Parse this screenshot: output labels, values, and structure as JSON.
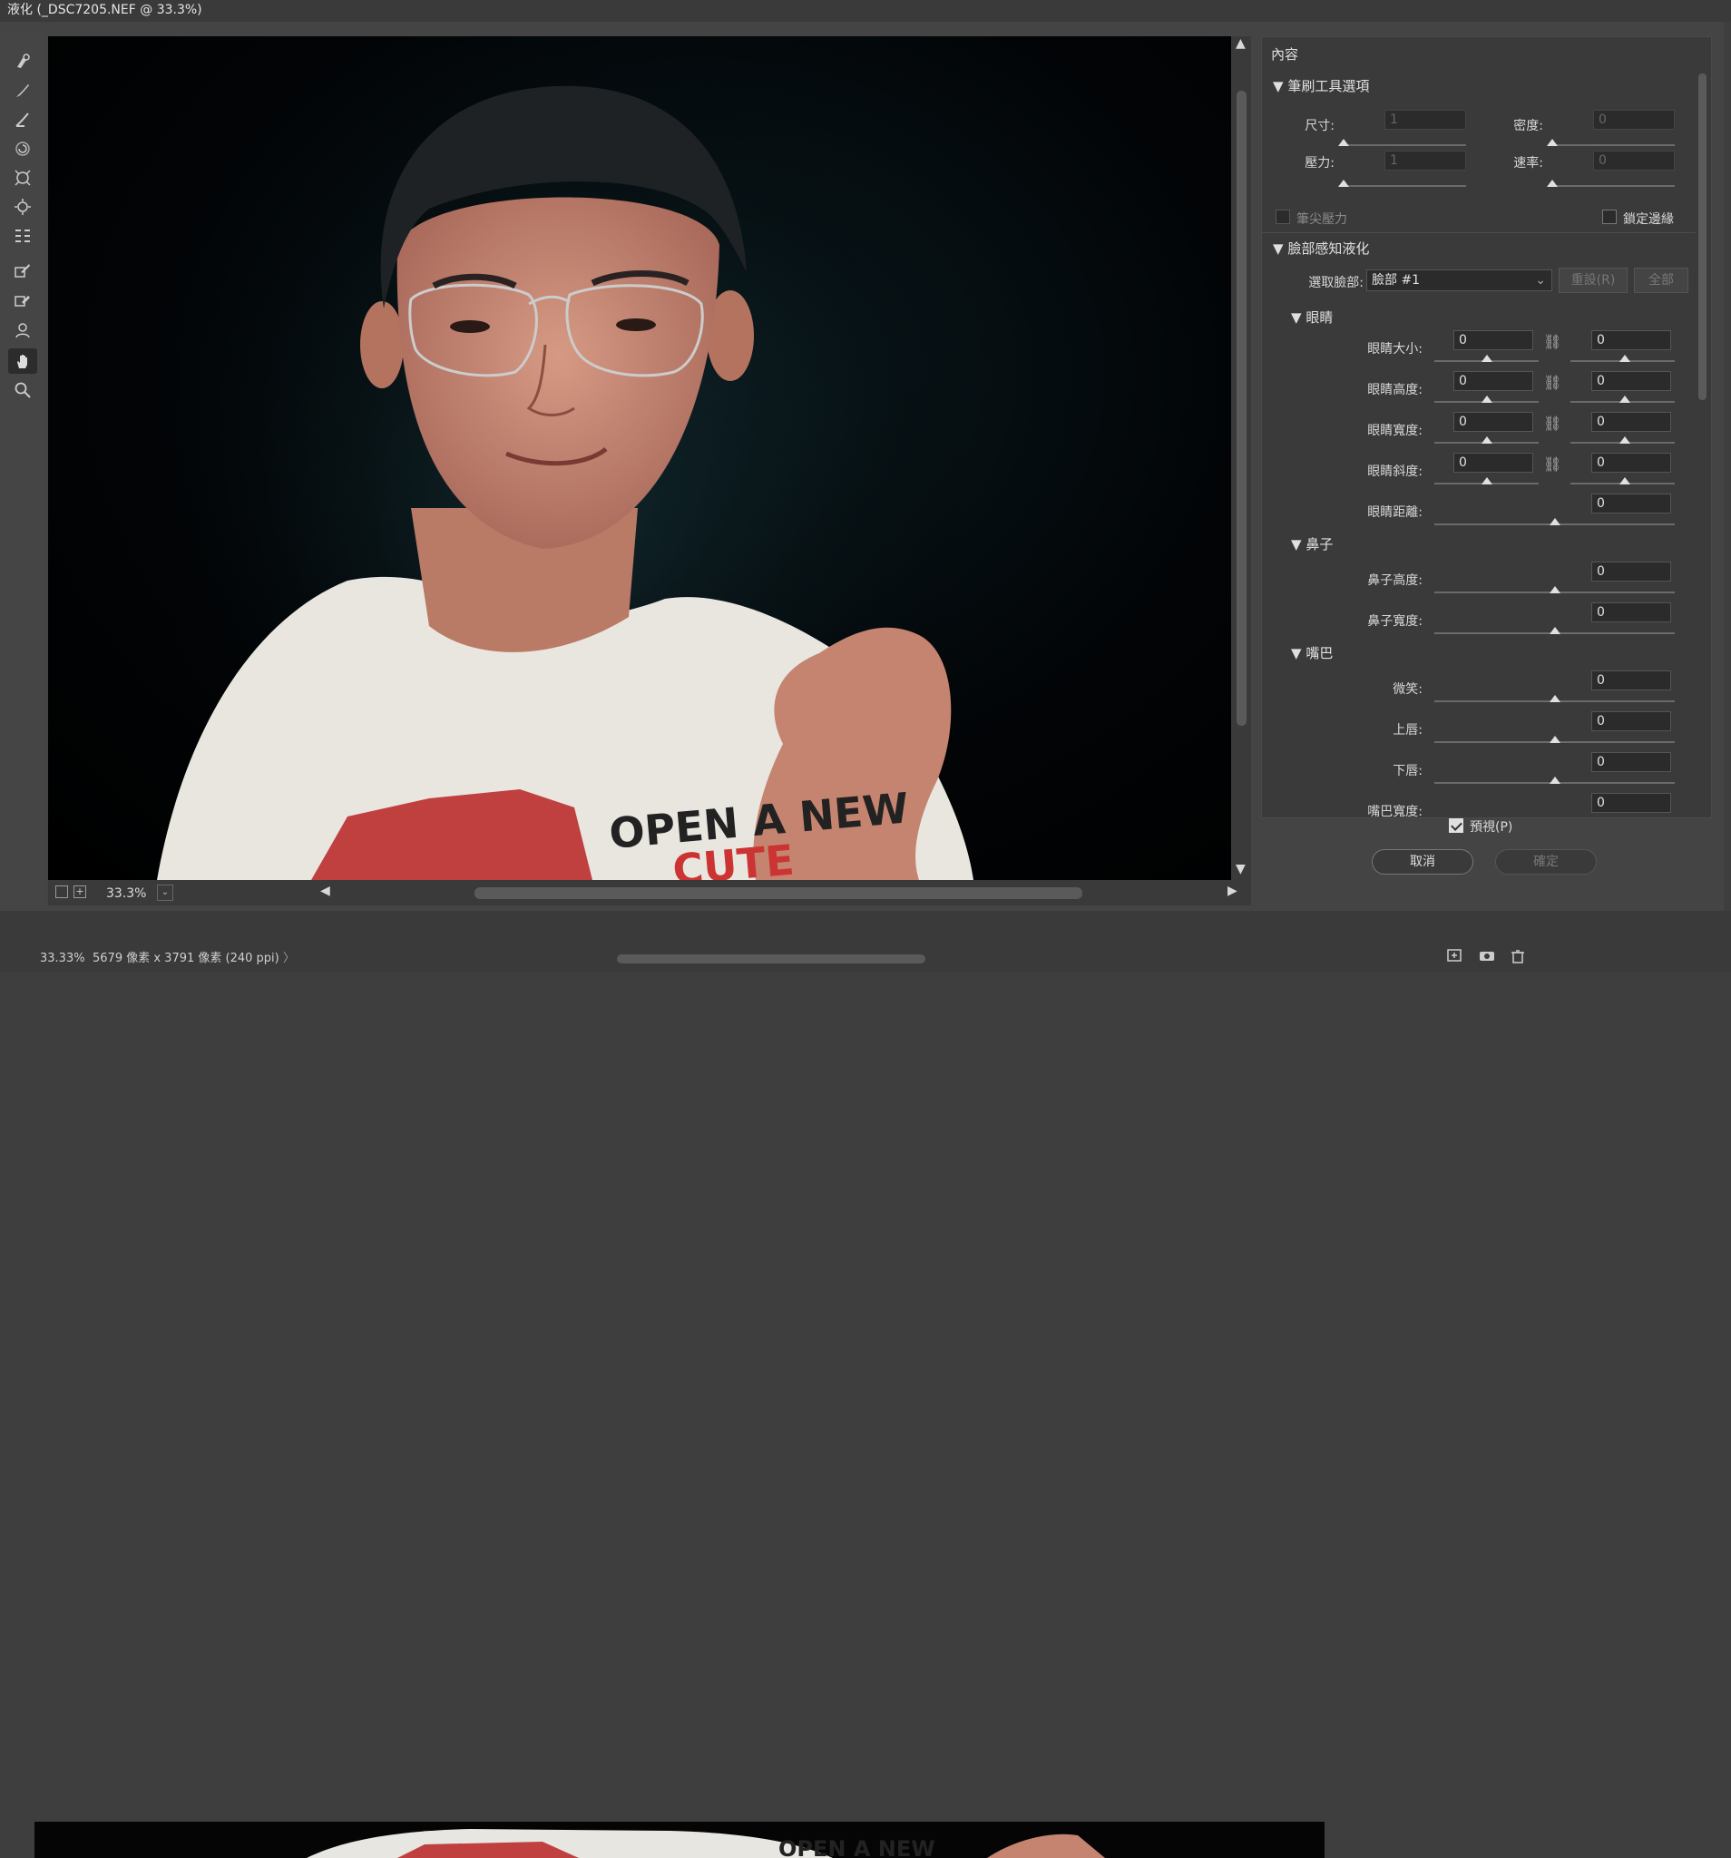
{
  "window": {
    "title": "液化 (_DSC7205.NEF @ 33.3%)"
  },
  "tools": [
    {
      "icon": "forward-warp-icon"
    },
    {
      "icon": "reconstruct-icon"
    },
    {
      "icon": "smooth-icon"
    },
    {
      "icon": "twirl-icon"
    },
    {
      "icon": "pucker-icon"
    },
    {
      "icon": "bloat-icon"
    },
    {
      "icon": "push-left-icon"
    },
    {
      "icon": "freeze-mask-icon"
    },
    {
      "icon": "thaw-mask-icon"
    },
    {
      "icon": "face-tool-icon"
    },
    {
      "icon": "hand-icon",
      "active": true
    },
    {
      "icon": "zoom-icon"
    }
  ],
  "canvas": {
    "shirt_text_1": "OPEN A NEW",
    "shirt_text_2": "CUTE"
  },
  "bottom": {
    "zoom": "33.3%"
  },
  "panel": {
    "title": "內容",
    "brush": {
      "header": "筆刷工具選項",
      "size_label": "尺寸:",
      "size_value": "1",
      "density_label": "密度:",
      "density_value": "0",
      "pressure_label": "壓力:",
      "pressure_value": "1",
      "rate_label": "速率:",
      "rate_value": "0",
      "stylus_label": "筆尖壓力",
      "pin_edges_label": "鎖定邊緣"
    },
    "face": {
      "header": "臉部感知液化",
      "select_label": "選取臉部:",
      "select_value": "臉部 #1",
      "reset_label": "重設(R)",
      "all_label": "全部",
      "eyes": {
        "header": "眼睛",
        "rows": [
          {
            "label": "眼睛大小:",
            "left": "0",
            "right": "0"
          },
          {
            "label": "眼睛高度:",
            "left": "0",
            "right": "0"
          },
          {
            "label": "眼睛寬度:",
            "left": "0",
            "right": "0"
          },
          {
            "label": "眼睛斜度:",
            "left": "0",
            "right": "0"
          }
        ],
        "distance_label": "眼睛距離:",
        "distance_value": "0"
      },
      "nose": {
        "header": "鼻子",
        "height_label": "鼻子高度:",
        "height_value": "0",
        "width_label": "鼻子寬度:",
        "width_value": "0"
      },
      "mouth": {
        "header": "嘴巴",
        "smile_label": "微笑:",
        "smile_value": "0",
        "upper_label": "上唇:",
        "upper_value": "0",
        "lower_label": "下唇:",
        "lower_value": "0",
        "width_label": "嘴巴寬度:",
        "width_value": "0"
      }
    },
    "preview_label": "預視(P)",
    "cancel_label": "取消",
    "ok_label": "確定"
  },
  "statusbar": {
    "zoom": "33.33%",
    "info": "5679 像素 x 3791 像素 (240 ppi)"
  },
  "background_canvas": {
    "shirt_text": "OPEN A NEW"
  }
}
